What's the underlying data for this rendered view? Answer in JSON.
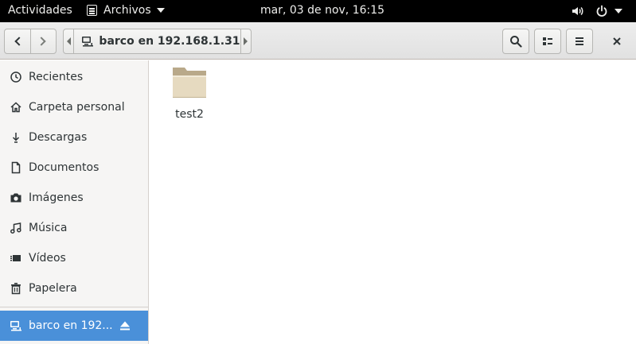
{
  "topbar": {
    "activities": "Actividades",
    "app_name": "Archivos",
    "clock": "mar, 03 de nov, 16:15",
    "icons": [
      "volume-icon",
      "power-icon",
      "system-menu-caret-icon"
    ]
  },
  "headerbar": {
    "location": "barco en 192.168.1.31",
    "icons": [
      "back-icon",
      "forward-icon",
      "network-computer-icon",
      "search-icon",
      "list-view-icon",
      "menu-icon",
      "close-icon"
    ]
  },
  "sidebar": {
    "items": [
      {
        "label": "Recientes",
        "icon": "clock-icon"
      },
      {
        "label": "Carpeta personal",
        "icon": "home-icon"
      },
      {
        "label": "Descargas",
        "icon": "download-icon"
      },
      {
        "label": "Documentos",
        "icon": "document-icon"
      },
      {
        "label": "Imágenes",
        "icon": "camera-icon"
      },
      {
        "label": "Música",
        "icon": "music-icon"
      },
      {
        "label": "Vídeos",
        "icon": "video-icon"
      },
      {
        "label": "Papelera",
        "icon": "trash-icon"
      }
    ],
    "mounted": {
      "label": "barco en 192...",
      "icon": "network-computer-icon",
      "action_icon": "eject-icon"
    }
  },
  "content": {
    "files": [
      {
        "name": "test2",
        "type": "folder"
      }
    ]
  },
  "colors": {
    "accent": "#4a90d9",
    "topbar_bg": "#000000",
    "folder": "#d7c9a7"
  }
}
